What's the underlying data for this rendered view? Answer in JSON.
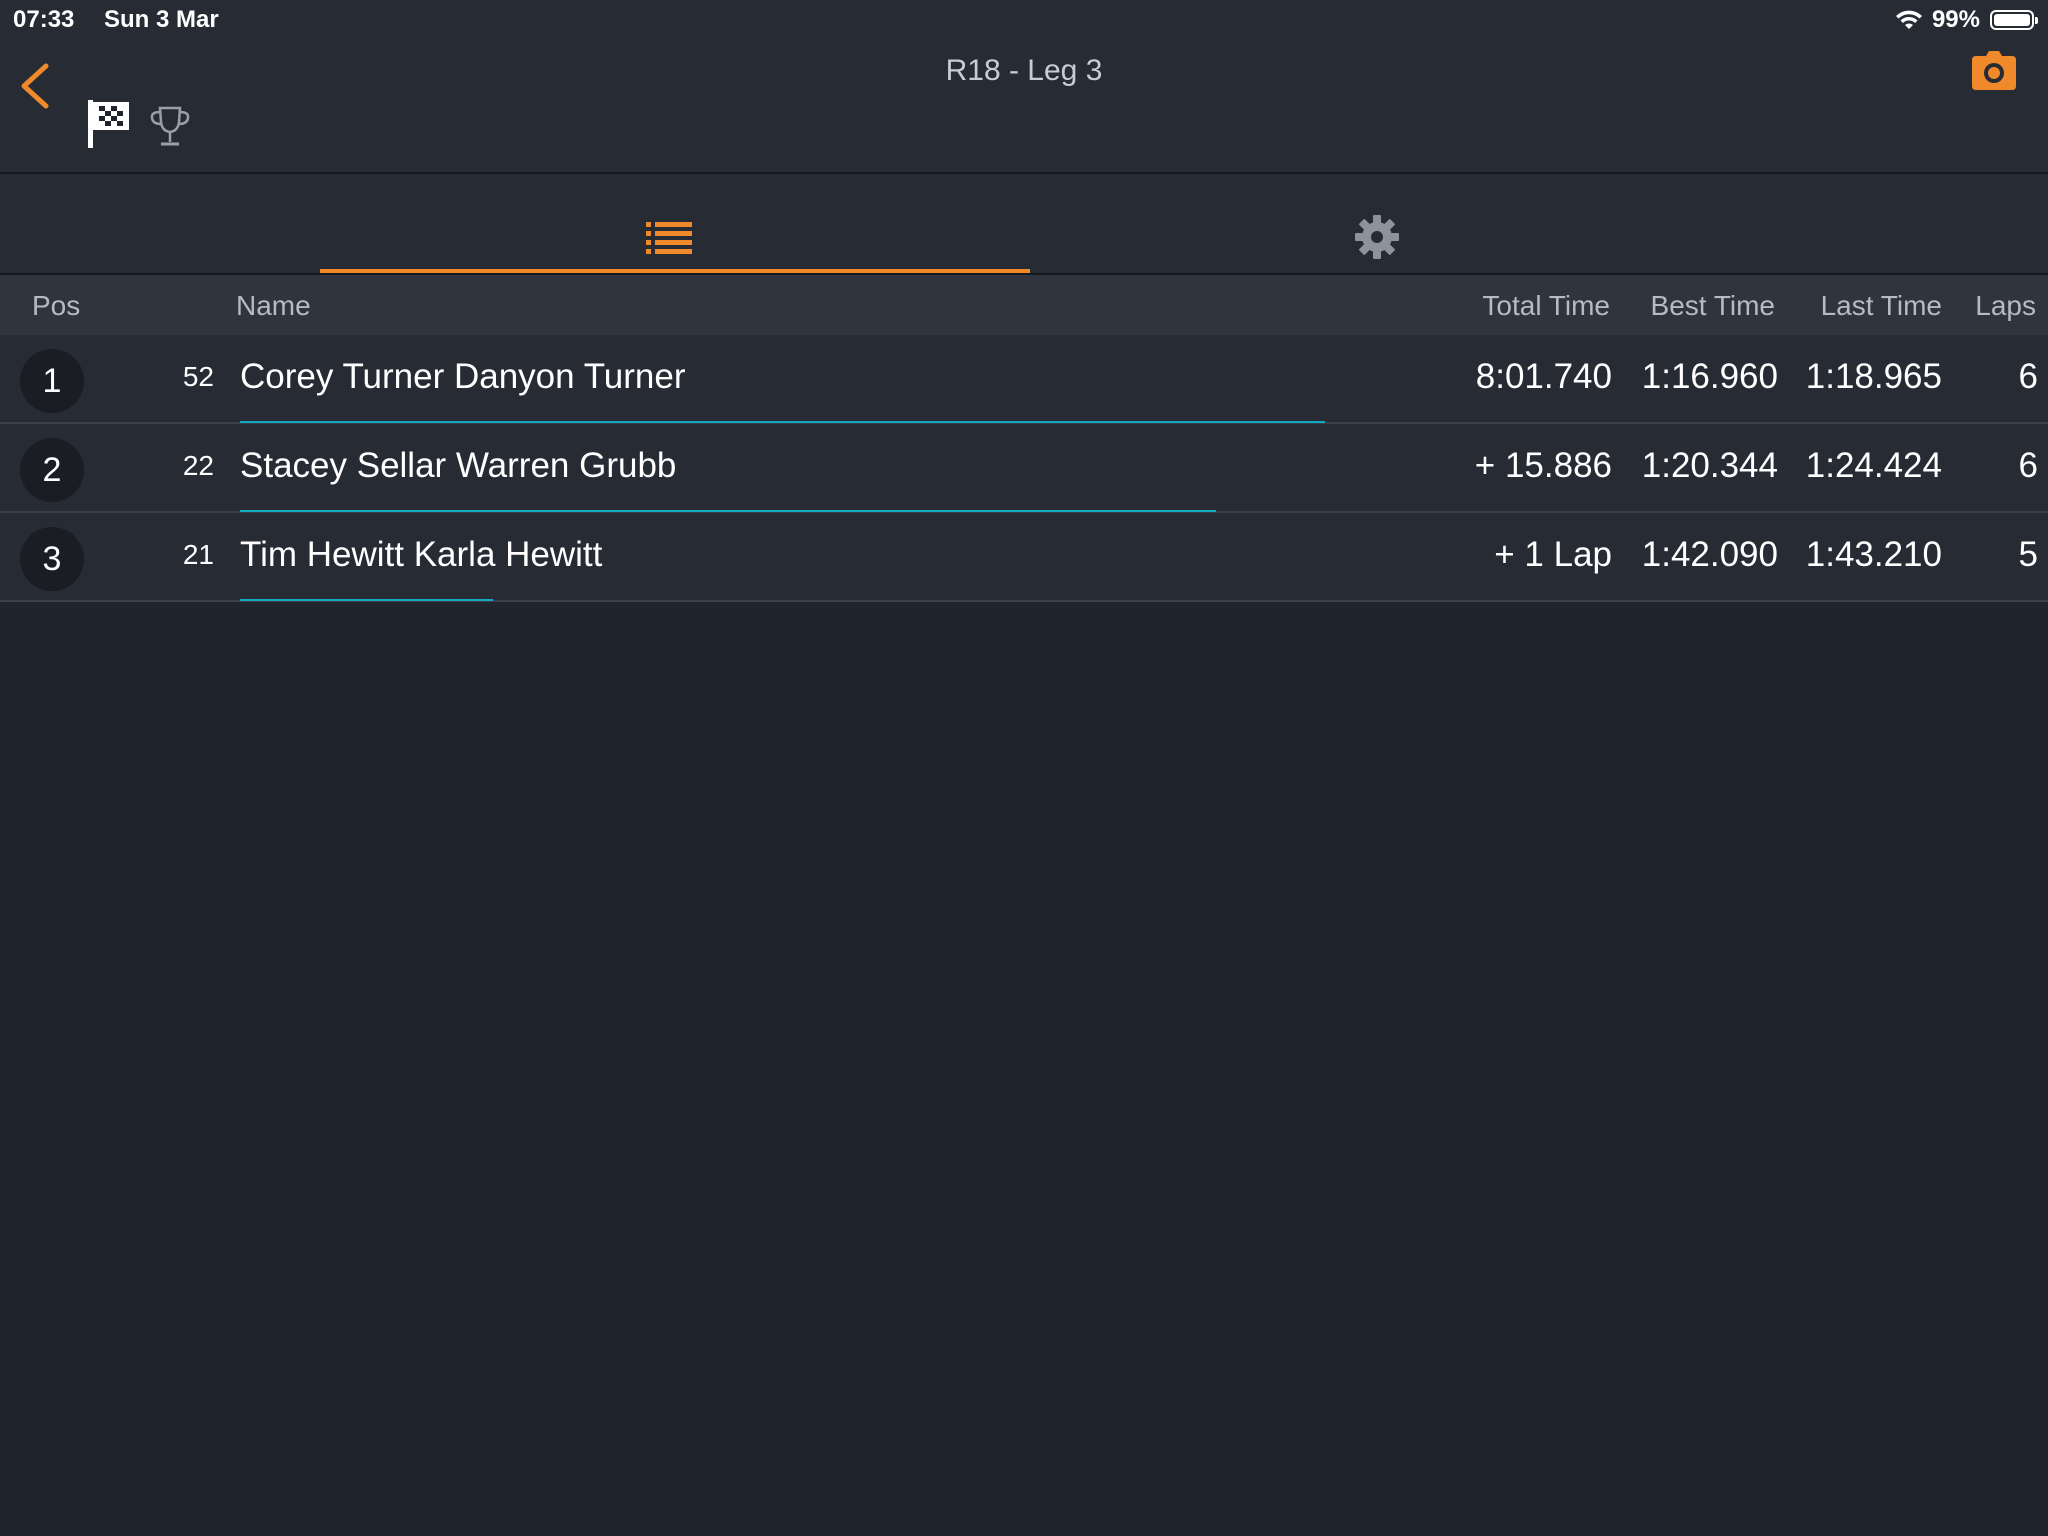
{
  "status_bar": {
    "time": "07:33",
    "date": "Sun 3 Mar",
    "battery": "99%",
    "battery_level": 0.99
  },
  "nav": {
    "title": "R18 - Leg 3",
    "back_icon": "chevron-left-icon",
    "camera_icon": "camera-icon",
    "flag_icon": "checkered-flag-icon",
    "trophy_icon": "trophy-icon"
  },
  "tabs": [
    {
      "icon": "list-icon",
      "active": true
    },
    {
      "icon": "gear-icon",
      "active": false
    }
  ],
  "colors": {
    "accent": "#f0892a",
    "progress": "#12aac0",
    "background": "#20242d",
    "panel": "#272b34"
  },
  "table": {
    "headers": {
      "pos": "Pos",
      "name": "Name",
      "total": "Total Time",
      "best": "Best Time",
      "last": "Last Time",
      "laps": "Laps"
    },
    "rows": [
      {
        "pos": "1",
        "car": "52",
        "name": "Corey Turner Danyon Turner",
        "total": "8:01.740",
        "best": "1:16.960",
        "last": "1:18.965",
        "laps": "6",
        "progress": 0.6
      },
      {
        "pos": "2",
        "car": "22",
        "name": "Stacey Sellar Warren Grubb",
        "total": "+ 15.886",
        "best": "1:20.344",
        "last": "1:24.424",
        "laps": "6",
        "progress": 0.54
      },
      {
        "pos": "3",
        "car": "21",
        "name": "Tim Hewitt Karla Hewitt",
        "total": "+ 1 Lap",
        "best": "1:42.090",
        "last": "1:43.210",
        "laps": "5",
        "progress": 0.14
      }
    ]
  }
}
